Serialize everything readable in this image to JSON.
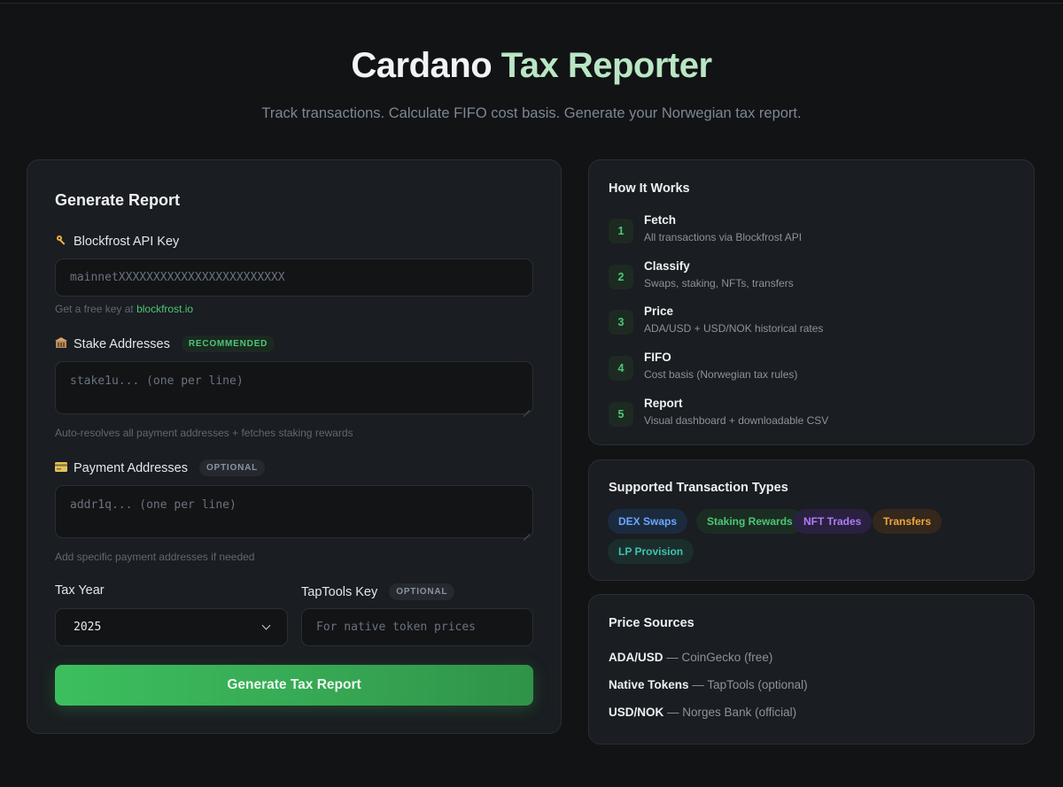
{
  "header": {
    "title_part1": "Cardano",
    "title_part2": "Tax Reporter",
    "subtitle": "Track transactions. Calculate FIFO cost basis. Generate your Norwegian tax report."
  },
  "form": {
    "title": "Generate Report",
    "api_key": {
      "icon": "key-icon",
      "label": "Blockfrost API Key",
      "placeholder": "mainnetXXXXXXXXXXXXXXXXXXXXXXXX",
      "hint_prefix": "Get a free key at",
      "hint_link": "blockfrost.io"
    },
    "stake": {
      "icon": "bank-icon",
      "label": "Stake Addresses",
      "tag": "RECOMMENDED",
      "placeholder": "stake1u... (one per line)",
      "hint": "Auto-resolves all payment addresses + fetches staking rewards"
    },
    "payment": {
      "icon": "card-icon",
      "label": "Payment Addresses",
      "tag": "OPTIONAL",
      "placeholder": "addr1q... (one per line)",
      "hint": "Add specific payment addresses if needed"
    },
    "tax_year": {
      "label": "Tax Year",
      "value": "2025"
    },
    "taptools": {
      "label": "TapTools Key",
      "tag": "OPTIONAL",
      "placeholder": "For native token prices"
    },
    "submit_label": "Generate Tax Report"
  },
  "how_it_works": {
    "title": "How It Works",
    "steps": [
      {
        "num": "1",
        "name": "Fetch",
        "desc": "All transactions via Blockfrost API"
      },
      {
        "num": "2",
        "name": "Classify",
        "desc": "Swaps, staking, NFTs, transfers"
      },
      {
        "num": "3",
        "name": "Price",
        "desc": "ADA/USD + USD/NOK historical rates"
      },
      {
        "num": "4",
        "name": "FIFO",
        "desc": "Cost basis (Norwegian tax rules)"
      },
      {
        "num": "5",
        "name": "Report",
        "desc": "Visual dashboard + downloadable CSV"
      }
    ]
  },
  "tx_types": {
    "title": "Supported Transaction Types",
    "items": [
      {
        "label": "DEX Swaps",
        "color": "#6aa8ff",
        "bg": "#1c2a3e"
      },
      {
        "label": "Staking Rewards",
        "color": "#4cc776",
        "bg": "#1b2d22"
      },
      {
        "label": "NFT Trades",
        "color": "#b07cf5",
        "bg": "#2a2040"
      },
      {
        "label": "Transfers",
        "color": "#f0a641",
        "bg": "#33281b"
      },
      {
        "label": "LP Provision",
        "color": "#3fc1b0",
        "bg": "#1b2e2c"
      }
    ]
  },
  "price_sources": {
    "title": "Price Sources",
    "items": [
      {
        "name": "ADA/USD",
        "source": "— CoinGecko (free)"
      },
      {
        "name": "Native Tokens",
        "source": "— TapTools (optional)"
      },
      {
        "name": "USD/NOK",
        "source": "— Norges Bank (official)"
      }
    ]
  }
}
